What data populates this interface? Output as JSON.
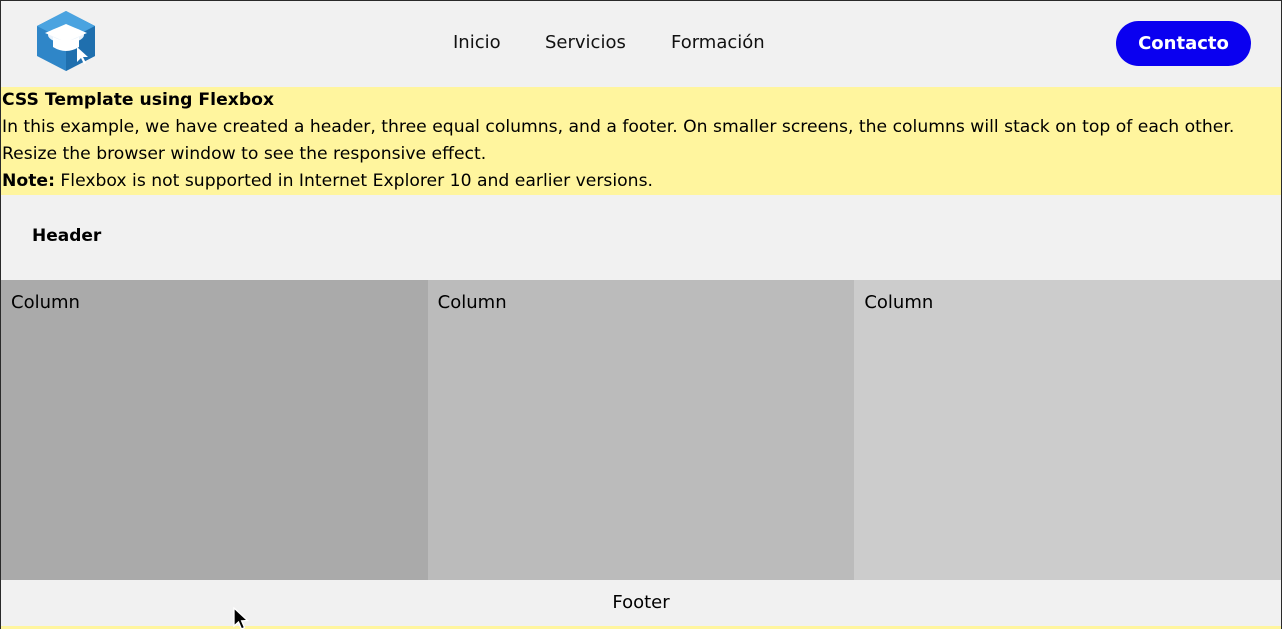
{
  "nav": {
    "links": [
      "Inicio",
      "Servicios",
      "Formación"
    ],
    "contact_label": "Contacto",
    "logo_icon": "graduation-cap-logo"
  },
  "note": {
    "title": "CSS Template using Flexbox",
    "line1": "In this example, we have created a header, three equal columns, and a footer. On smaller screens, the columns will stack on top of each other.",
    "line2": "Resize the browser window to see the responsive effect.",
    "note_label": "Note:",
    "note_text": " Flexbox is not supported in Internet Explorer 10 and earlier versions."
  },
  "header": {
    "text": "Header"
  },
  "columns": [
    "Column",
    "Column",
    "Column"
  ],
  "footer": {
    "text": "Footer"
  },
  "colors": {
    "accent": "#0a00f0",
    "note_bg": "#fff59e",
    "col1": "#aaaaaa",
    "col2": "#bbbbbb",
    "col3": "#cccccc"
  }
}
